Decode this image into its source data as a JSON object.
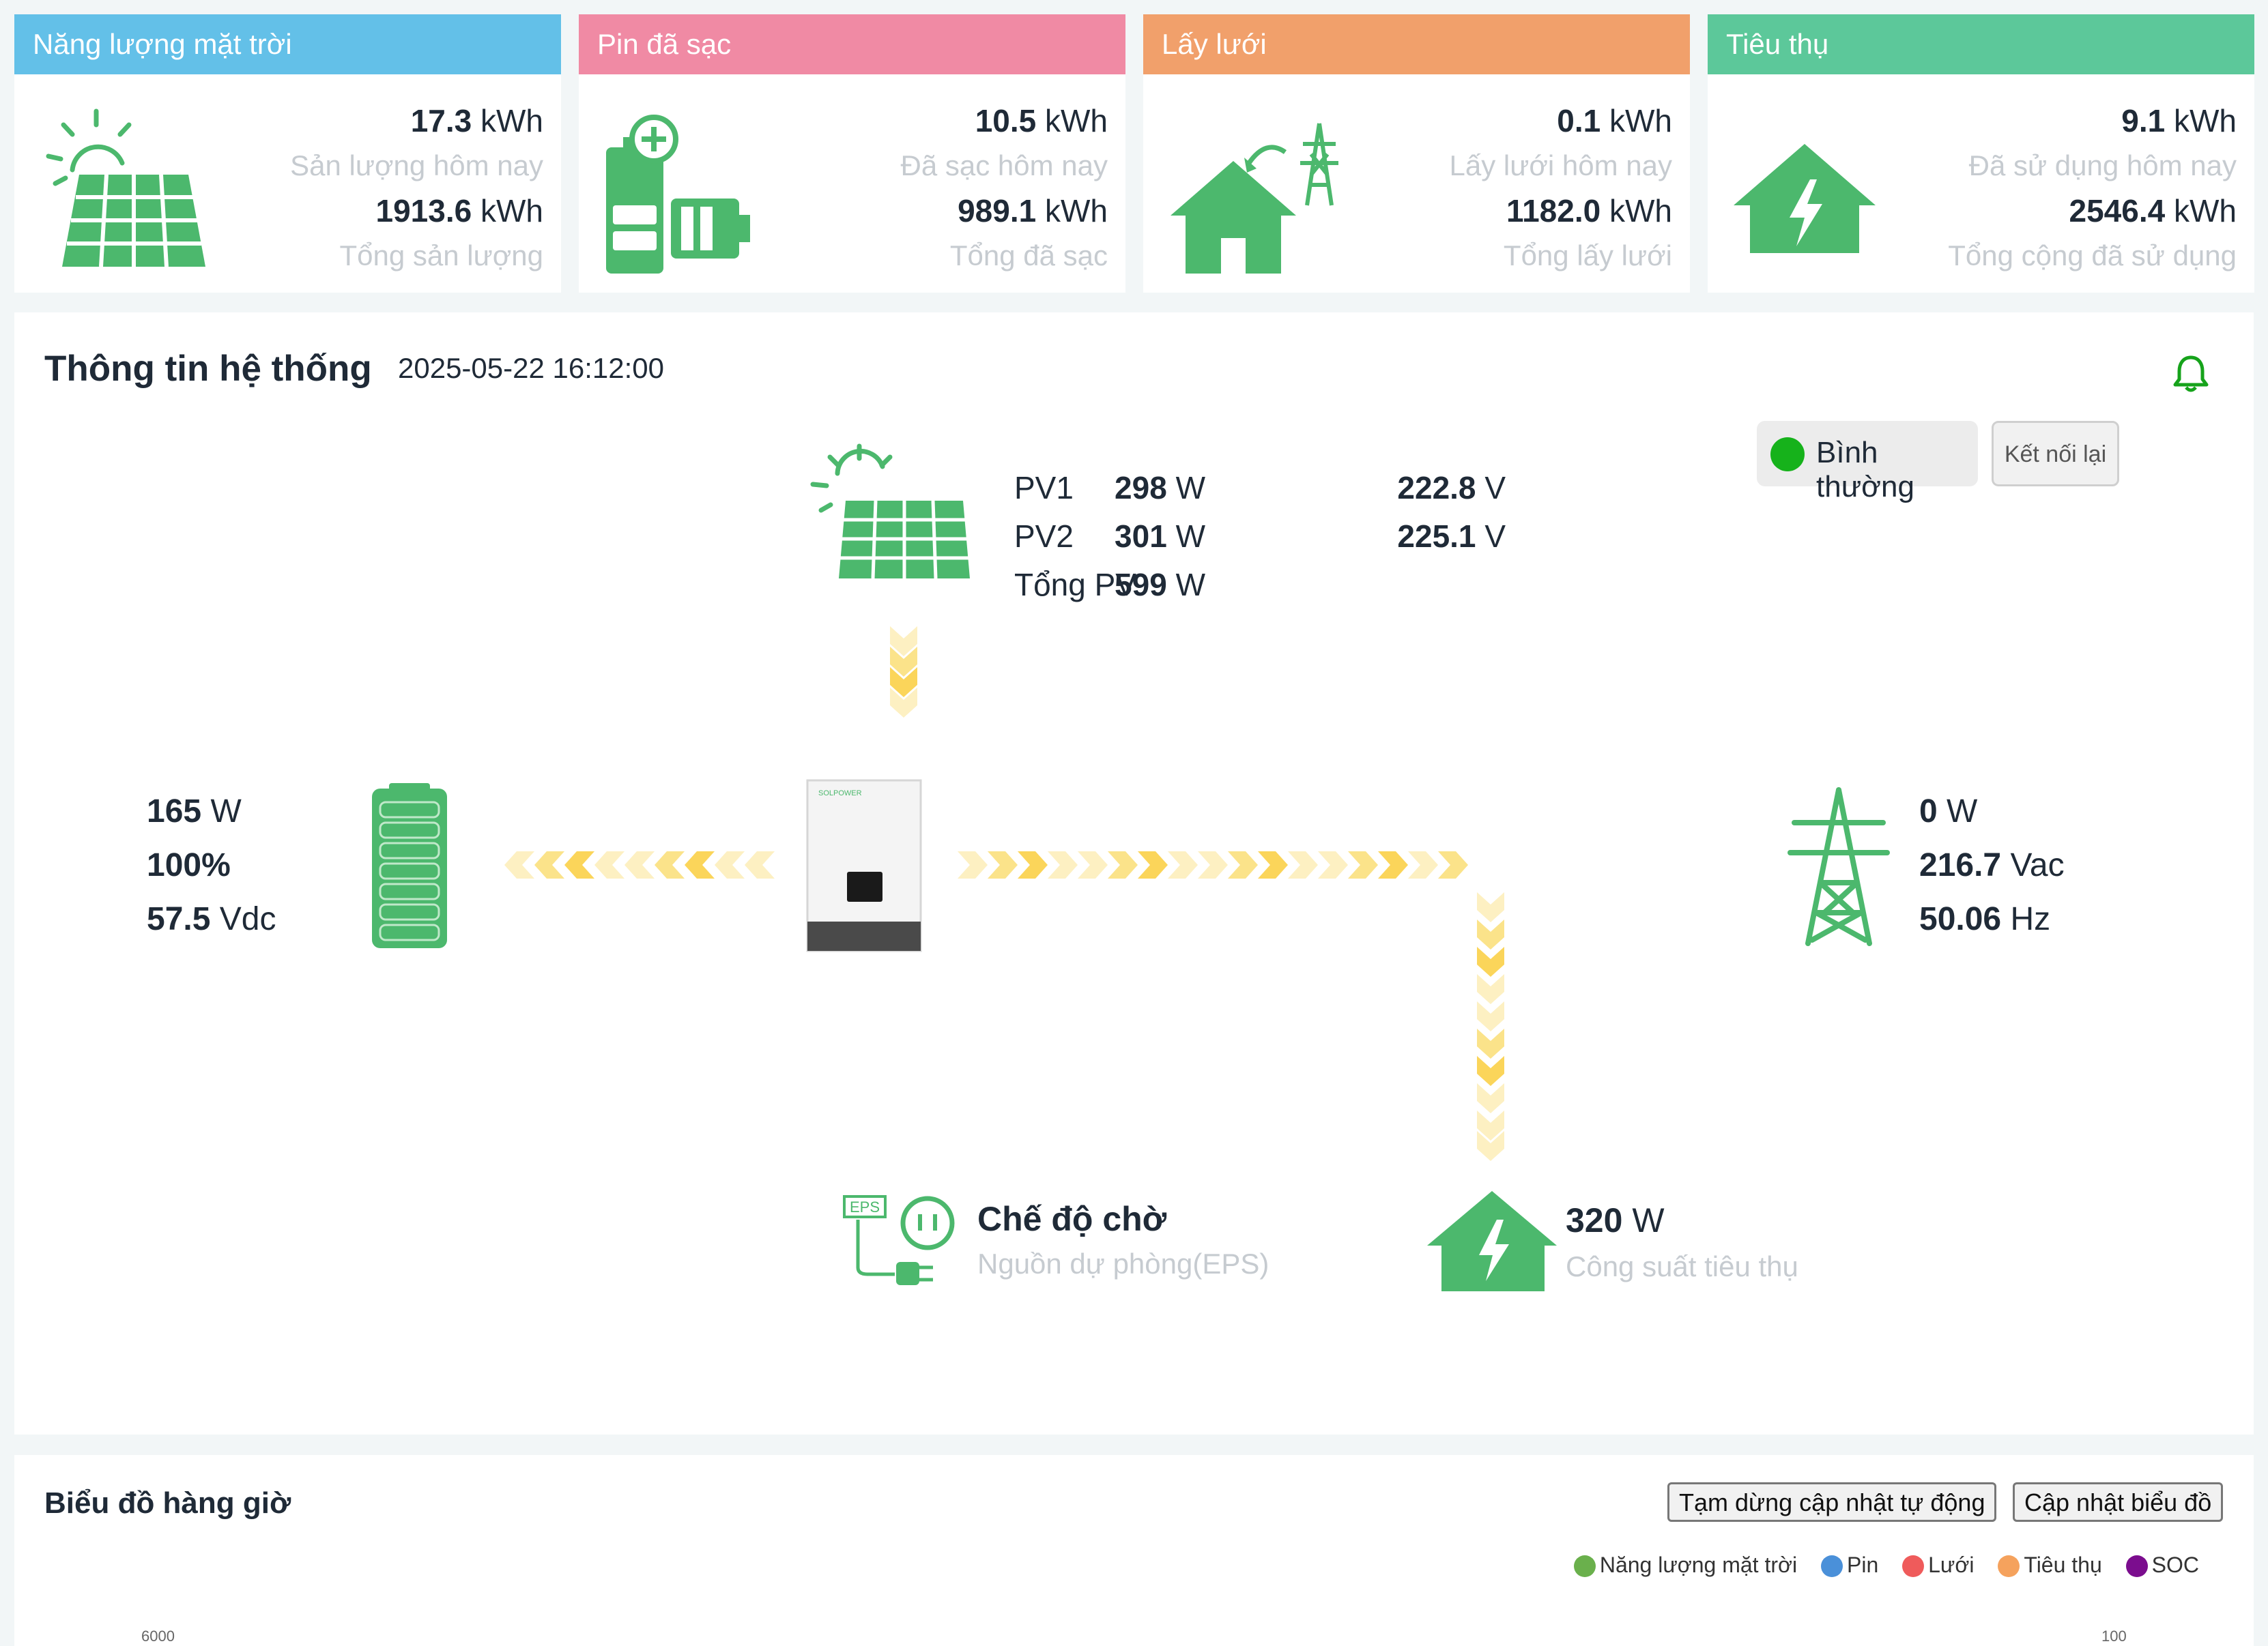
{
  "colors": {
    "solar": "#63c0e8",
    "battery": "#f08aa4",
    "grid": "#f1a06b",
    "consumption": "#5cc89a",
    "icon_green": "#4cb86d",
    "status_ok": "#16b21b"
  },
  "cards": [
    {
      "title": "Năng lượng mặt trời",
      "icon": "solar-panel-icon",
      "today_value": "17.3",
      "today_unit": "kWh",
      "today_label": "Sản lượng hôm nay",
      "total_value": "1913.6",
      "total_unit": "kWh",
      "total_label": "Tổng sản lượng"
    },
    {
      "title": "Pin đã sạc",
      "icon": "battery-charge-icon",
      "today_value": "10.5",
      "today_unit": "kWh",
      "today_label": "Đã sạc hôm nay",
      "total_value": "989.1",
      "total_unit": "kWh",
      "total_label": "Tổng đã sạc"
    },
    {
      "title": "Lấy lưới",
      "icon": "grid-house-icon",
      "today_value": "0.1",
      "today_unit": "kWh",
      "today_label": "Lấy lưới hôm nay",
      "total_value": "1182.0",
      "total_unit": "kWh",
      "total_label": "Tổng lấy lưới"
    },
    {
      "title": "Tiêu thụ",
      "icon": "home-power-icon",
      "today_value": "9.1",
      "today_unit": "kWh",
      "today_label": "Đã sử dụng hôm nay",
      "total_value": "2546.4",
      "total_unit": "kWh",
      "total_label": "Tổng cộng đã sử dụng"
    }
  ],
  "system": {
    "title": "Thông tin hệ thống",
    "timestamp": "2025-05-22 16:12:00",
    "status": "Bình thường",
    "reconnect": "Kết nối lại",
    "pv": [
      {
        "label": "PV1",
        "power": "298",
        "power_unit": "W",
        "voltage": "222.8",
        "voltage_unit": "V"
      },
      {
        "label": "PV2",
        "power": "301",
        "power_unit": "W",
        "voltage": "225.1",
        "voltage_unit": "V"
      },
      {
        "label": "Tổng PV",
        "power": "599",
        "power_unit": "W"
      }
    ],
    "battery": {
      "power": "165",
      "power_unit": "W",
      "soc": "100%",
      "voltage": "57.5",
      "voltage_unit": "Vdc"
    },
    "grid": {
      "power": "0",
      "power_unit": "W",
      "voltage": "216.7",
      "voltage_unit": "Vac",
      "frequency": "50.06",
      "frequency_unit": "Hz"
    },
    "eps": {
      "title": "Chế độ chờ",
      "subtitle": "Nguồn dự phòng(EPS)",
      "badge": "EPS"
    },
    "load": {
      "power": "320",
      "power_unit": "W",
      "label": "Công suất tiêu thụ"
    },
    "inverter_brand": "SOLPOWER"
  },
  "chart": {
    "title": "Biểu đồ hàng giờ",
    "pause_button": "Tạm dừng cập nhật tự động",
    "refresh_button": "Cập nhật biểu đồ",
    "legend": [
      {
        "name": "Năng lượng mặt trời",
        "color": "#6ab04c"
      },
      {
        "name": "Pin",
        "color": "#4a90d9"
      },
      {
        "name": "Lưới",
        "color": "#ef5b5b"
      },
      {
        "name": "Tiêu thụ",
        "color": "#f5a25d"
      },
      {
        "name": "SOC",
        "color": "#7b0d8e"
      }
    ],
    "y_left_top": "6000",
    "y_right_top": "100"
  }
}
